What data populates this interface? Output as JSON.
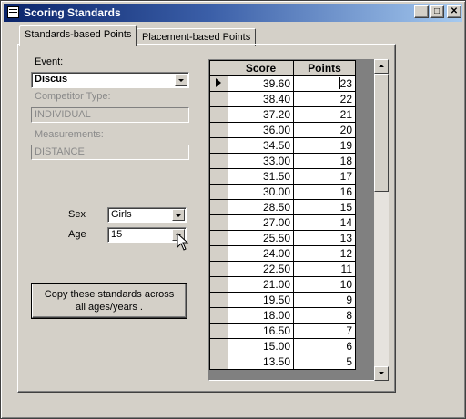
{
  "window": {
    "title": "Scoring Standards",
    "minimize": "_",
    "maximize": "□",
    "close": "✕"
  },
  "tabs": [
    {
      "label": "Standards-based Points",
      "active": true
    },
    {
      "label": "Placement-based Points",
      "active": false
    }
  ],
  "form": {
    "event_label": "Event:",
    "event_value": "Discus",
    "competitor_type_label": "Competitor Type:",
    "competitor_type_value": "INDIVIDUAL",
    "measurements_label": "Measurements:",
    "measurements_value": "DISTANCE",
    "sex_label": "Sex",
    "sex_value": "Girls",
    "age_label": "Age",
    "age_value": "15",
    "copy_button": "Copy these standards across all ages/years ."
  },
  "grid": {
    "columns": [
      "Score",
      "Points"
    ],
    "rows": [
      {
        "score": "39.60",
        "points": "23"
      },
      {
        "score": "38.40",
        "points": "22"
      },
      {
        "score": "37.20",
        "points": "21"
      },
      {
        "score": "36.00",
        "points": "20"
      },
      {
        "score": "34.50",
        "points": "19"
      },
      {
        "score": "33.00",
        "points": "18"
      },
      {
        "score": "31.50",
        "points": "17"
      },
      {
        "score": "30.00",
        "points": "16"
      },
      {
        "score": "28.50",
        "points": "15"
      },
      {
        "score": "27.00",
        "points": "14"
      },
      {
        "score": "25.50",
        "points": "13"
      },
      {
        "score": "24.00",
        "points": "12"
      },
      {
        "score": "22.50",
        "points": "11"
      },
      {
        "score": "21.00",
        "points": "10"
      },
      {
        "score": "19.50",
        "points": "9"
      },
      {
        "score": "18.00",
        "points": "8"
      },
      {
        "score": "16.50",
        "points": "7"
      },
      {
        "score": "15.00",
        "points": "6"
      },
      {
        "score": "13.50",
        "points": "5"
      }
    ]
  },
  "colors": {
    "titlebar_start": "#0a246a",
    "titlebar_end": "#a6caf0",
    "face": "#d4d0c8"
  }
}
